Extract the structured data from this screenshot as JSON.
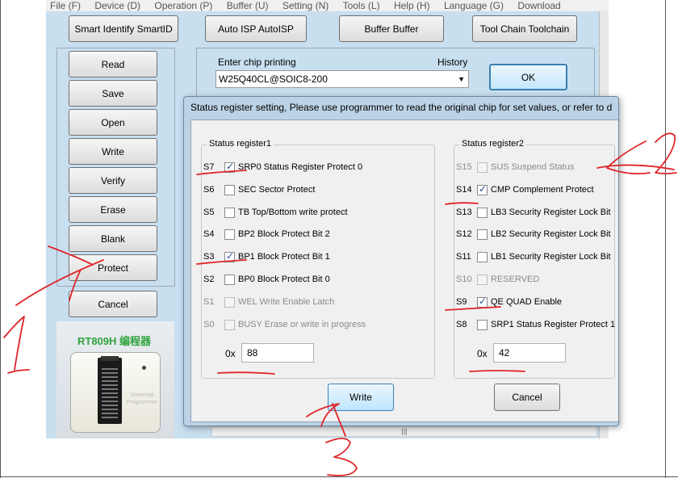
{
  "menu": [
    "File (F)",
    "Device (D)",
    "Operation (P)",
    "Buffer (U)",
    "Setting (N)",
    "Tools (L)",
    "Help (H)",
    "Language (G)",
    "Download"
  ],
  "toolbar": {
    "smart_id": "Smart Identify SmartID",
    "auto_isp": "Auto ISP AutoISP",
    "buffer": "Buffer Buffer",
    "toolchain": "Tool Chain Toolchain"
  },
  "actions": {
    "read": "Read",
    "save": "Save",
    "open": "Open",
    "write": "Write",
    "verify": "Verify",
    "erase": "Erase",
    "blank": "Blank",
    "protect": "Protect",
    "cancel": "Cancel"
  },
  "chip": {
    "label": "Enter chip printing",
    "history_label": "History",
    "value": "W25Q40CL@SOIC8-200",
    "ok": "OK"
  },
  "product": {
    "title": "RT809H 编程器",
    "device_text": "Universal Programmer"
  },
  "dialog": {
    "title": "Status register setting, Please use programmer to read the original chip for set values, or refer to d",
    "sr1": {
      "title": "Status register1",
      "rows": [
        {
          "id": "S7",
          "name": "SRP0 Status Register Protect 0",
          "checked": true,
          "disabled": false
        },
        {
          "id": "S6",
          "name": "SEC  Sector Protect",
          "checked": false,
          "disabled": false
        },
        {
          "id": "S5",
          "name": "TB   Top/Bottom write protect",
          "checked": false,
          "disabled": false
        },
        {
          "id": "S4",
          "name": "BP2  Block Protect Bit 2",
          "checked": false,
          "disabled": false
        },
        {
          "id": "S3",
          "name": "BP1  Block Protect Bit 1",
          "checked": true,
          "disabled": false
        },
        {
          "id": "S2",
          "name": "BP0  Block Protect Bit 0",
          "checked": false,
          "disabled": false
        },
        {
          "id": "S1",
          "name": "WEL  Write Enable Latch",
          "checked": false,
          "disabled": true
        },
        {
          "id": "S0",
          "name": "BUSY Erase or write in progress",
          "checked": false,
          "disabled": true
        }
      ],
      "hex_prefix": "0x",
      "hex_value": "88"
    },
    "sr2": {
      "title": "Status register2",
      "rows": [
        {
          "id": "S15",
          "name": "SUS  Suspend Status",
          "checked": false,
          "disabled": true
        },
        {
          "id": "S14",
          "name": "CMP  Complement Protect",
          "checked": true,
          "disabled": false
        },
        {
          "id": "S13",
          "name": "LB3  Security Register Lock Bit",
          "checked": false,
          "disabled": false
        },
        {
          "id": "S12",
          "name": "LB2  Security Register Lock Bit",
          "checked": false,
          "disabled": false
        },
        {
          "id": "S11",
          "name": "LB1  Security Register Lock Bit",
          "checked": false,
          "disabled": false
        },
        {
          "id": "S10",
          "name": "RESERVED",
          "checked": false,
          "disabled": true
        },
        {
          "id": "S9",
          "name": "QE   QUAD Enable",
          "checked": true,
          "disabled": false
        },
        {
          "id": "S8",
          "name": "SRP1 Status Register Protect 1",
          "checked": false,
          "disabled": false
        }
      ],
      "hex_prefix": "0x",
      "hex_value": "42"
    },
    "write": "Write",
    "cancel": "Cancel"
  },
  "scrollbar": {
    "thumb_glyph": "|||"
  },
  "annotation": {
    "color": "#e0262a",
    "numbers": [
      "1",
      "2",
      "3"
    ]
  }
}
